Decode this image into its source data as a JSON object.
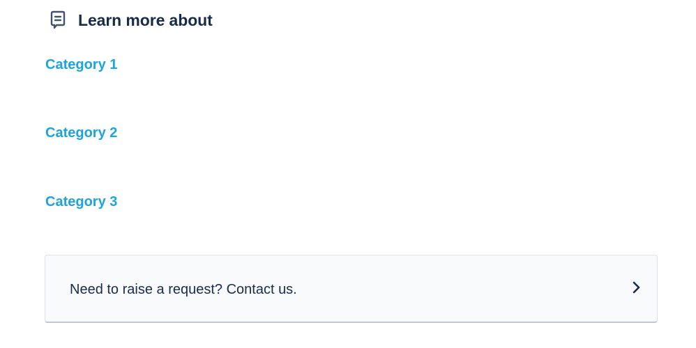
{
  "section": {
    "icon": "knowledge-article-icon",
    "title": "Learn more about"
  },
  "categories": [
    {
      "label": "Category 1"
    },
    {
      "label": "Category 2"
    },
    {
      "label": "Category 3"
    }
  ],
  "request_card": {
    "text": "Need to raise a request? Contact us.",
    "icon": "chevron-right-icon"
  },
  "colors": {
    "link": "#1ba4de",
    "text": "#172b4d",
    "card_background": "#f9fafb",
    "card_border": "#dfe1e6"
  }
}
